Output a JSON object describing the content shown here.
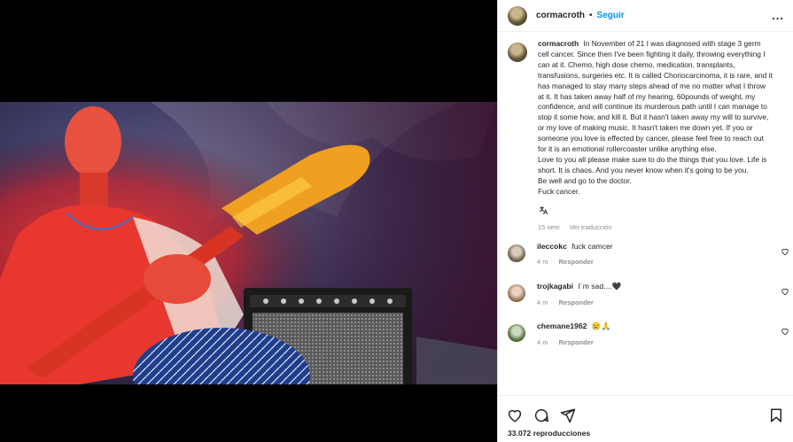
{
  "post": {
    "username": "cormacroth",
    "separator": "•",
    "follow_label": "Seguir",
    "more_label": "...",
    "caption": "In November of 21 I was diagnosed with stage 3 germ cell cancer. Since then I've been fighting it daily, throwing everything I can at it. Chemo, high dose chemo, medication, transplants, transfusions, surgeries etc. It is called Choriocarcinoma, it is rare, and it has managed to stay many steps ahead of me no matter what I throw at it. It has taken away half of my hearing, 60pounds of weight, my confidence, and will continue its murderous path until I can manage to stop it some how, and kill it. But it hasn't taken away my will to survive, or my love of making music. It hasn't taken me down yet. If you or someone you love is effected by cancer, please feel free to reach out for it is an emotional rollercoaster unlike anything else.\nLove to you all please make sure to do the things that you love. Life is short. It is chaos. And you never know when it's going to be you.\nBe well and go to the doctor.\nFuck cancer.",
    "caption_age": "15 sem",
    "see_translation": "Ver traducción",
    "views_count": "33.072",
    "views_label": "reproducciones"
  },
  "comments": [
    {
      "username": "ileccokc",
      "text": "fuck camcer",
      "age": "4 m",
      "reply_label": "Responder"
    },
    {
      "username": "trojkagabi",
      "text": "I´m sad....🖤",
      "age": "4 m",
      "reply_label": "Responder"
    },
    {
      "username": "chemane1962",
      "text": "😢🙏",
      "age": "4 m",
      "reply_label": "Responder"
    }
  ],
  "icons": {
    "avatar": "avatar",
    "like": "heart-icon",
    "comment": "comment-icon",
    "share": "share-icon",
    "save": "bookmark-icon",
    "translate": "translate-icon"
  },
  "colors": {
    "follow": "#0095f6",
    "muted": "#8e8e8e",
    "text": "#262626"
  }
}
